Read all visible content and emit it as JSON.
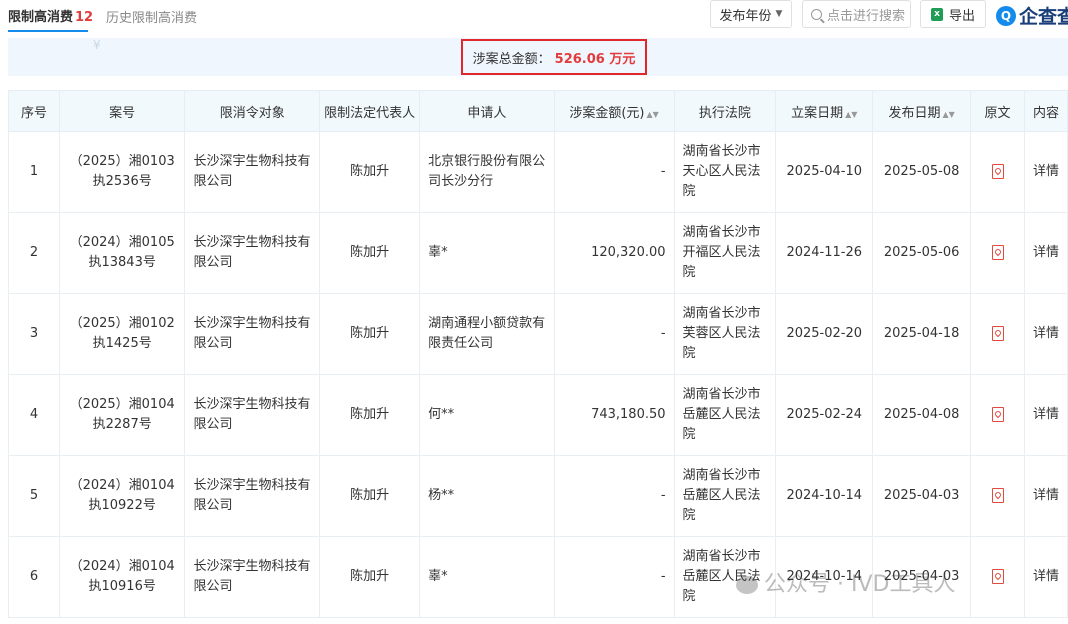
{
  "tabs": {
    "active_label": "限制高消费",
    "active_count": "12",
    "history_label": "历史限制高消费"
  },
  "toolbar": {
    "year_label": "发布年份",
    "search_placeholder": "点击进行搜索",
    "export_label": "导出",
    "brand": "企查查"
  },
  "summary": {
    "label": "涉案总金额：",
    "amount": "526.06 万元"
  },
  "table": {
    "headers": [
      "序号",
      "案号",
      "限消令对象",
      "限制法定代表人",
      "申请人",
      "涉案金额(元)",
      "执行法院",
      "立案日期",
      "发布日期",
      "原文",
      "内容"
    ],
    "rows": [
      {
        "idx": "1",
        "case_no": "（2025）湘0103执2536号",
        "target": "长沙深宇生物科技有限公司",
        "rep": "陈加升",
        "applicant": "北京银行股份有限公司长沙分行",
        "applicant_link": true,
        "amount": "-",
        "court": "湖南省长沙市天心区人民法院",
        "filed": "2025-04-10",
        "published": "2025-05-08",
        "detail": "详情"
      },
      {
        "idx": "2",
        "case_no": "（2024）湘0105执13843号",
        "target": "长沙深宇生物科技有限公司",
        "rep": "陈加升",
        "applicant": "辜*",
        "applicant_link": false,
        "amount": "120,320.00",
        "court": "湖南省长沙市开福区人民法院",
        "filed": "2024-11-26",
        "published": "2025-05-06",
        "detail": "详情"
      },
      {
        "idx": "3",
        "case_no": "（2025）湘0102执1425号",
        "target": "长沙深宇生物科技有限公司",
        "rep": "陈加升",
        "applicant": "湖南通程小额贷款有限责任公司",
        "applicant_link": true,
        "amount": "-",
        "court": "湖南省长沙市芙蓉区人民法院",
        "filed": "2025-02-20",
        "published": "2025-04-18",
        "detail": "详情"
      },
      {
        "idx": "4",
        "case_no": "（2025）湘0104执2287号",
        "target": "长沙深宇生物科技有限公司",
        "rep": "陈加升",
        "applicant": "何**",
        "applicant_link": false,
        "amount": "743,180.50",
        "court": "湖南省长沙市岳麓区人民法院",
        "filed": "2025-02-24",
        "published": "2025-04-08",
        "detail": "详情"
      },
      {
        "idx": "5",
        "case_no": "（2024）湘0104执10922号",
        "target": "长沙深宇生物科技有限公司",
        "rep": "陈加升",
        "applicant": "杨**",
        "applicant_link": false,
        "amount": "-",
        "court": "湖南省长沙市岳麓区人民法院",
        "filed": "2024-10-14",
        "published": "2025-04-03",
        "detail": "详情"
      },
      {
        "idx": "6",
        "case_no": "（2024）湘0104执10916号",
        "target": "长沙深宇生物科技有限公司",
        "rep": "陈加升",
        "applicant": "辜*",
        "applicant_link": false,
        "amount": "-",
        "court": "湖南省长沙市岳麓区人民法院",
        "filed": "2024-10-14",
        "published": "2025-04-03",
        "detail": "详情"
      }
    ]
  },
  "watermark": "公众号 · IVD工具人",
  "colors": {
    "accent": "#128bed",
    "danger": "#e23b3b",
    "header_bg": "#f2f9fc"
  }
}
